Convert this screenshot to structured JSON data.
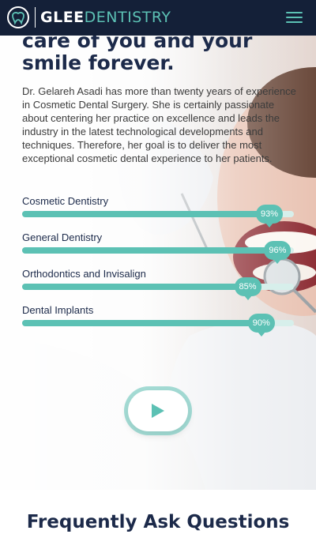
{
  "brand": {
    "name_part1": "GLEE",
    "name_part2": "DENTISTRY"
  },
  "icons": {
    "logo": "tooth-logo-icon",
    "menu": "hamburger-menu-icon",
    "play": "play-icon"
  },
  "colors": {
    "navy": "#142038",
    "teal": "#5cc1b4",
    "heading": "#1c2a4a"
  },
  "hero": {
    "heading_line1": "care of you and your",
    "heading_line2": "smile forever.",
    "description": "Dr. Gelareh Asadi has more than twenty years of experience in Cosmetic Dental Surgery. She is certainly passionate about centering her practice on excellence and leads the industry in the latest technological developments and techniques. Therefore, her goal is to deliver the most exceptional cosmetic dental experience to her patients."
  },
  "skills": [
    {
      "label": "Cosmetic Dentistry",
      "percent_label": "93%",
      "value": 93
    },
    {
      "label": "General Dentistry",
      "percent_label": "96%",
      "value": 96
    },
    {
      "label": "Orthodontics and Invisalign",
      "percent_label": "85%",
      "value": 85
    },
    {
      "label": "Dental Implants",
      "percent_label": "90%",
      "value": 90
    }
  ],
  "faq": {
    "title": "Frequently Ask Questions"
  }
}
